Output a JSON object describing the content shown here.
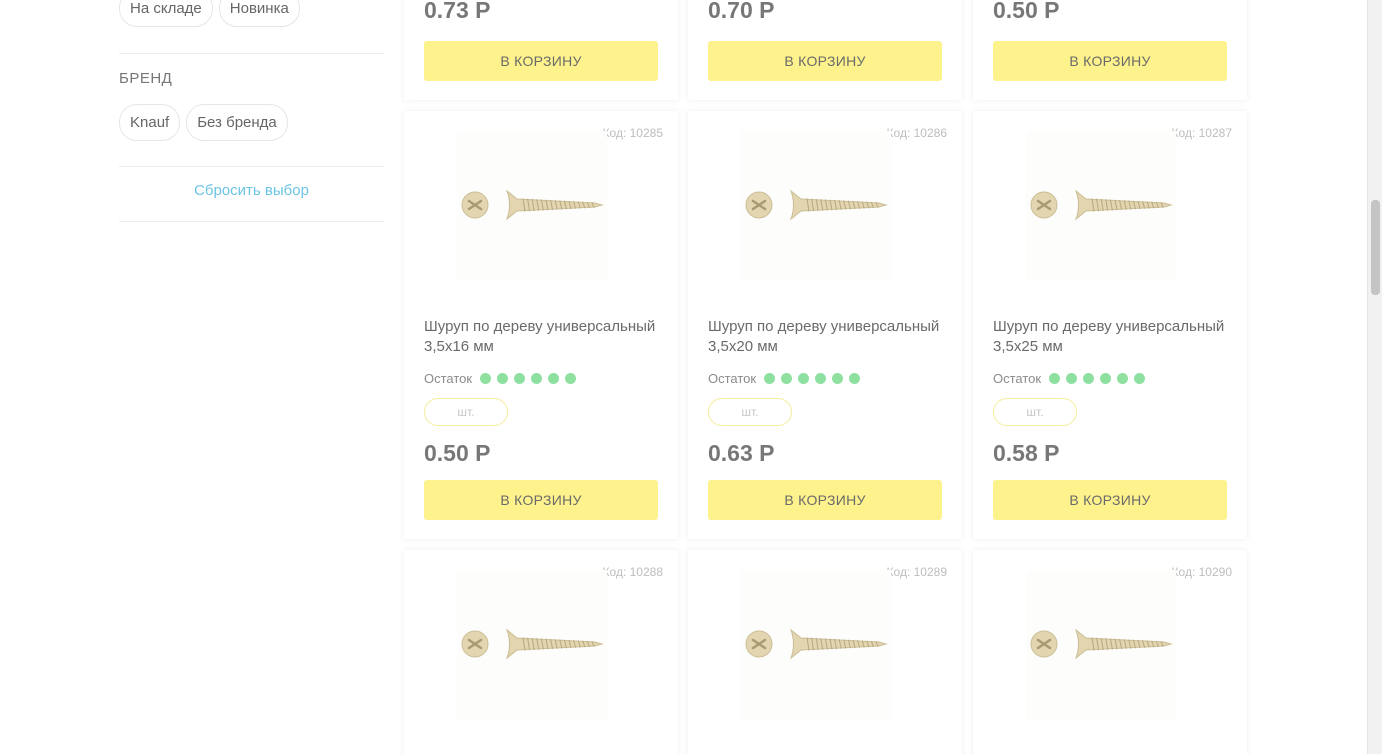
{
  "sidebar": {
    "availability_chips": [
      "На складе",
      "Новинка"
    ],
    "brand_title": "БРЕНД",
    "brand_chips": [
      "Knauf",
      "Без бренда"
    ],
    "reset_label": "Сбросить выбор"
  },
  "top_row": [
    {
      "price": "0.73 Р",
      "cart_label": "В КОРЗИНУ"
    },
    {
      "price": "0.70 Р",
      "cart_label": "В КОРЗИНУ"
    },
    {
      "price": "0.50 Р",
      "cart_label": "В КОРЗИНУ"
    }
  ],
  "middle_row": [
    {
      "code": "Код: 10285",
      "name": "Шуруп по дереву универсальный 3,5х16 мм",
      "stock_label": "Остаток",
      "stock_dots": 6,
      "unit": "шт.",
      "price": "0.50 Р",
      "cart_label": "В КОРЗИНУ"
    },
    {
      "code": "Код: 10286",
      "name": "Шуруп по дереву универсальный 3,5х20 мм",
      "stock_label": "Остаток",
      "stock_dots": 6,
      "unit": "шт.",
      "price": "0.63 Р",
      "cart_label": "В КОРЗИНУ"
    },
    {
      "code": "Код: 10287",
      "name": "Шуруп по дереву универсальный 3,5х25 мм",
      "stock_label": "Остаток",
      "stock_dots": 6,
      "unit": "шт.",
      "price": "0.58 Р",
      "cart_label": "В КОРЗИНУ"
    }
  ],
  "bottom_row": [
    {
      "code": "Код: 10288"
    },
    {
      "code": "Код: 10289"
    },
    {
      "code": "Код: 10290"
    }
  ],
  "colors": {
    "cart_button": "#fdf28c",
    "stock_dot": "#8ee0a1",
    "reset_link": "#6cc4e6",
    "screw": "#e3d5b0"
  },
  "icons": {
    "product_image": "screw-icon"
  }
}
